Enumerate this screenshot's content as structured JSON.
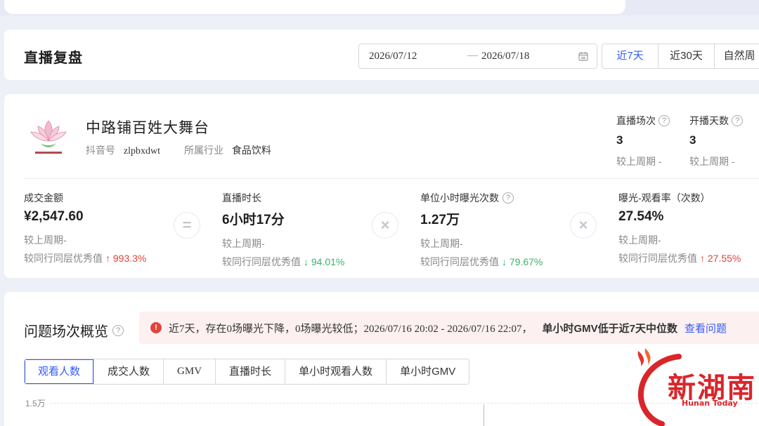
{
  "header": {
    "title": "直播复盘",
    "date_start": "2026/07/12",
    "date_sep": "—",
    "date_end": "2026/07/18",
    "range_tabs": [
      "近7天",
      "近30天",
      "自然周"
    ]
  },
  "account": {
    "name": "中路铺百姓大舞台",
    "douyin_label": "抖音号",
    "douyin_id": "zlpbxdwt",
    "industry_label": "所属行业",
    "industry": "食品饮料",
    "sessions": {
      "label": "直播场次",
      "value": "3",
      "compare": "较上周期 -"
    },
    "days": {
      "label": "开播天数",
      "value": "3",
      "compare": "较上周期 -"
    }
  },
  "metrics": [
    {
      "label": "成交金额",
      "value": "¥2,547.60",
      "compare": "较上周期-",
      "peer_label": "较同行同层优秀值",
      "peer_value": "↑ 993.3%",
      "peer_dir": "up",
      "help": false
    },
    {
      "label": "直播时长",
      "value": "6小时17分",
      "compare": "较上周期-",
      "peer_label": "较同行同层优秀值",
      "peer_value": "↓ 94.01%",
      "peer_dir": "down",
      "help": false
    },
    {
      "label": "单位小时曝光次数",
      "value": "1.27万",
      "compare": "较上周期-",
      "peer_label": "较同行同层优秀值",
      "peer_value": "↓ 79.67%",
      "peer_dir": "down",
      "help": true
    },
    {
      "label": "曝光-观看率（次数）",
      "value": "27.54%",
      "compare": "较上周期-",
      "peer_label": "较同行同层优秀值",
      "peer_value": "↑ 27.55%",
      "peer_dir": "up",
      "help": false
    }
  ],
  "operators": [
    "=",
    "×",
    "×"
  ],
  "problem": {
    "title": "问题场次概览",
    "alert_text": "近7天，存在0场曝光下降，0场曝光较低；2026/07/16 20:02 - 2026/07/16 22:07，",
    "alert_strong": "单小时GMV低于近7天中位数",
    "alert_link": "查看问题",
    "tabs": [
      "观看人数",
      "成交人数",
      "GMV",
      "直播时长",
      "单小时观看人数",
      "单小时GMV"
    ],
    "axis_label": "1.5万"
  },
  "watermark": {
    "text": "新湖南",
    "sub": "Hunan Today"
  },
  "colors": {
    "accent": "#2f5bff",
    "up": "#e0453b",
    "down": "#3bb36a",
    "alert_bg": "#fdf0f0"
  }
}
